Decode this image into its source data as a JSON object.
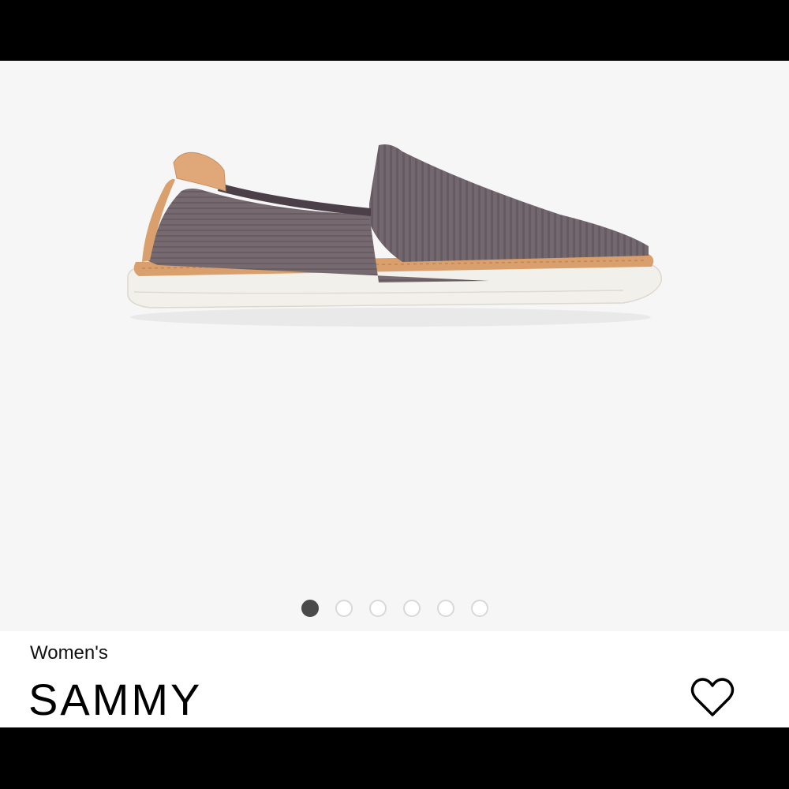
{
  "product": {
    "category": "Women's",
    "name": "SAMMY",
    "image_subject": "slip-on-sneaker",
    "colors": {
      "knit_upper": "#74686f",
      "leather_trim": "#d9a06e",
      "sole": "#f2f0ea"
    }
  },
  "gallery": {
    "total_images": 6,
    "active_index": 0
  },
  "actions": {
    "favorite_icon": "heart-outline-icon"
  }
}
